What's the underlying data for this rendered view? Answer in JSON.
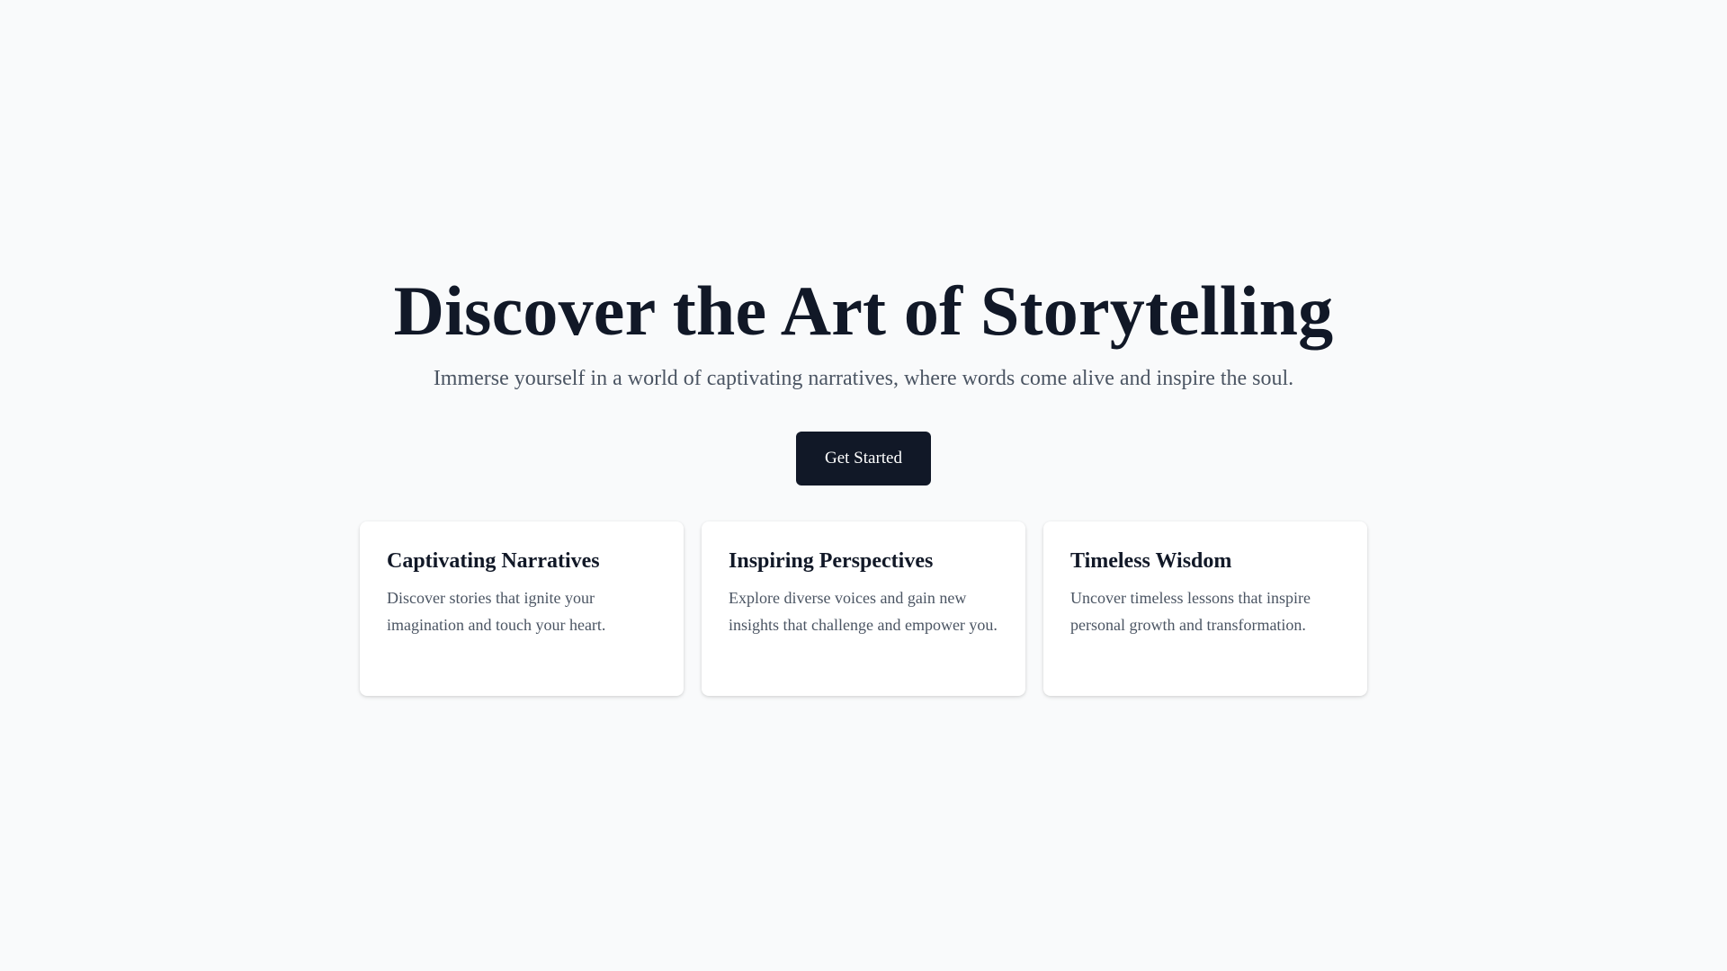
{
  "hero": {
    "title": "Discover the Art of Storytelling",
    "subtitle": "Immerse yourself in a world of captivating narratives, where words come alive and inspire the soul.",
    "cta_label": "Get Started"
  },
  "features": [
    {
      "title": "Captivating Narratives",
      "text": "Discover stories that ignite your imagination and touch your heart."
    },
    {
      "title": "Inspiring Perspectives",
      "text": "Explore diverse voices and gain new insights that challenge and empower you."
    },
    {
      "title": "Timeless Wisdom",
      "text": "Uncover timeless lessons that inspire personal growth and transformation."
    }
  ],
  "colors": {
    "background": "#f9fafb",
    "primary": "#111827",
    "muted_text": "#4b5563",
    "card_background": "#ffffff"
  }
}
